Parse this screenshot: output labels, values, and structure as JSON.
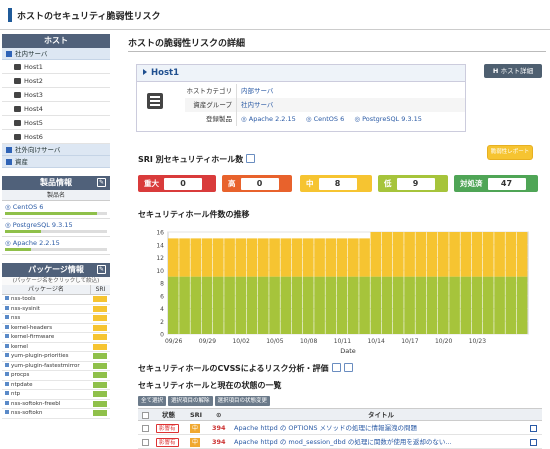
{
  "header": {
    "title": "ホストのセキュリティ脆弱性リスク"
  },
  "sidebar": {
    "host_heading": "ホスト",
    "groups": [
      {
        "label": "社内サーバ",
        "hosts": [
          "Host1",
          "Host2",
          "Host3",
          "Host4",
          "Host5",
          "Host6"
        ]
      },
      {
        "label": "社外向けサーバ",
        "hosts": []
      },
      {
        "label": "資産",
        "hosts": []
      }
    ],
    "products_heading": "製品情報",
    "products_col": "製品名",
    "products": [
      {
        "name": "CentOS 6",
        "fill": 0.9
      },
      {
        "name": "PostgreSQL 9.3.15",
        "fill": 0.35
      },
      {
        "name": "Apache 2.2.15",
        "fill": 0.25
      }
    ],
    "packages_heading": "パッケージ情報",
    "packages_note": "(パッケージ名をクリックして絞込)",
    "packages_col_name": "パッケージ名",
    "packages_col_sri": "SRI",
    "packages": [
      {
        "name": "nss-tools",
        "color": "#f6c431"
      },
      {
        "name": "nss-sysinit",
        "color": "#f6c431"
      },
      {
        "name": "nss",
        "color": "#f6c431"
      },
      {
        "name": "kernel-headers",
        "color": "#f6c431"
      },
      {
        "name": "kernel-firmware",
        "color": "#f6c431"
      },
      {
        "name": "kernel",
        "color": "#f6c431"
      },
      {
        "name": "yum-plugin-priorities",
        "color": "#8fc04a"
      },
      {
        "name": "yum-plugin-fastestmirror",
        "color": "#8fc04a"
      },
      {
        "name": "procps",
        "color": "#8fc04a"
      },
      {
        "name": "ntpdate",
        "color": "#8fc04a"
      },
      {
        "name": "ntp",
        "color": "#8fc04a"
      },
      {
        "name": "nss-softokn-freebl",
        "color": "#8fc04a"
      },
      {
        "name": "nss-softokn",
        "color": "#8fc04a"
      }
    ]
  },
  "main": {
    "page_title": "ホストの脆弱性リスクの詳細",
    "host_detail_button": "ホスト詳細",
    "host": {
      "name": "Host1",
      "category_label": "ホストカテゴリ",
      "category_value": "内部サーバ",
      "group_label": "資産グループ",
      "group_value": "社内サーバ",
      "products_label": "登録製品",
      "products": [
        "Apache 2.2.15",
        "CentOS 6",
        "PostgreSQL 9.3.15"
      ]
    },
    "report_button": "脆弱性レポート",
    "sri_title": "SRI 別セキュリティホール数",
    "counts": [
      {
        "label": "重大",
        "value": "0",
        "color": "#d93b3b"
      },
      {
        "label": "高",
        "value": "0",
        "color": "#e8622c"
      },
      {
        "label": "中",
        "value": "8",
        "color": "#f6c431"
      },
      {
        "label": "低",
        "value": "9",
        "color": "#a6c43b"
      },
      {
        "label": "対処済",
        "value": "47",
        "color": "#4fa556"
      }
    ],
    "trend_title": "セキュリティホール件数の推移",
    "cvss_title": "セキュリティホールのCVSSによるリスク分析・評価",
    "list_title": "セキュリティホールと現在の状態の一覧",
    "list_buttons": [
      "全て選択",
      "選択項目の解除",
      "選択項目の状態変更"
    ],
    "columns": [
      "状態",
      "SRI",
      "タイトル"
    ],
    "rows": [
      {
        "status": "影響有",
        "sri": "中",
        "num": "394",
        "title": "Apache httpd の OPTIONS メソッドの処理に情報漏洩の問題"
      },
      {
        "status": "影響有",
        "sri": "中",
        "num": "394",
        "title": "Apache httpd の mod_session_dbd の処理に関数が使用を返却のない..."
      }
    ]
  },
  "chart_data": {
    "type": "bar",
    "xlabel": "Date",
    "ylim": [
      0,
      16
    ],
    "yticks": [
      0,
      2,
      4,
      6,
      8,
      10,
      12,
      14,
      16
    ],
    "xticks": [
      "09/26",
      "09/29",
      "10/02",
      "10/05",
      "10/08",
      "10/11",
      "10/14",
      "10/17",
      "10/20",
      "10/23"
    ],
    "series": [
      {
        "values": [
          9,
          9,
          9,
          9,
          9,
          9,
          9,
          9,
          9,
          9,
          9,
          9,
          9,
          9,
          9,
          9,
          9,
          9,
          9,
          9,
          9,
          9,
          9,
          9,
          9,
          9,
          9,
          9,
          9,
          9,
          9,
          9
        ],
        "color": "#a6c43b"
      },
      {
        "values": [
          6,
          6,
          6,
          6,
          6,
          6,
          6,
          6,
          6,
          6,
          6,
          6,
          6,
          6,
          6,
          6,
          6,
          6,
          7,
          7,
          7,
          7,
          7,
          7,
          7,
          7,
          7,
          7,
          7,
          7,
          7,
          7
        ],
        "color": "#f6c431"
      }
    ]
  }
}
